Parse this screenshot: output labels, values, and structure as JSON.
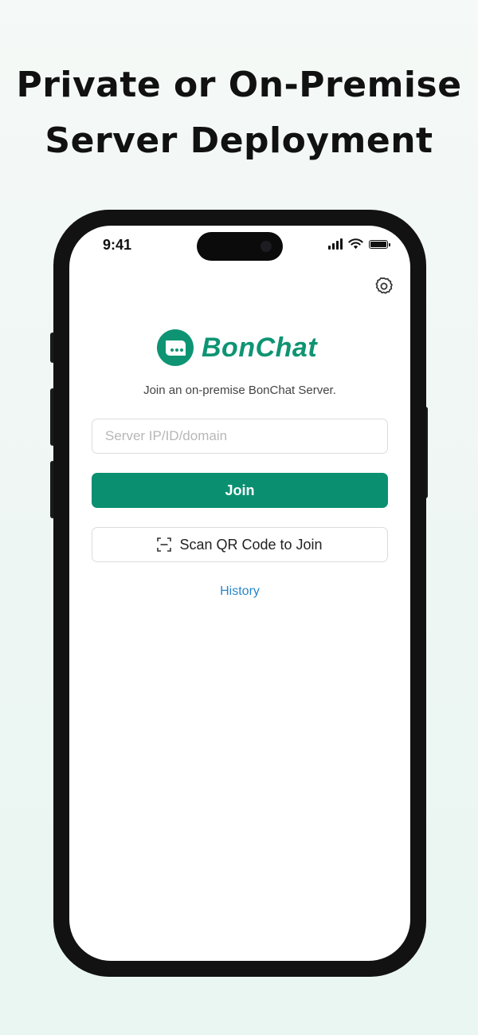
{
  "headline": {
    "line1": "Private or On-Premise",
    "line2": "Server Deployment"
  },
  "status_bar": {
    "time": "9:41",
    "icons": [
      "cellular-signal-icon",
      "wifi-icon",
      "battery-icon"
    ]
  },
  "app": {
    "settings_icon": "gear-icon",
    "logo_icon": "chat-bubble-icon",
    "logo_text": "BonChat",
    "brand_color": "#0e9473",
    "subtitle": "Join an on-premise BonChat Server.",
    "server_input": {
      "value": "",
      "placeholder": "Server IP/ID/domain"
    },
    "join_label": "Join",
    "scan_icon": "qr-scan-icon",
    "scan_label": "Scan QR Code to Join",
    "history_label": "History",
    "link_color": "#2a86c9"
  }
}
